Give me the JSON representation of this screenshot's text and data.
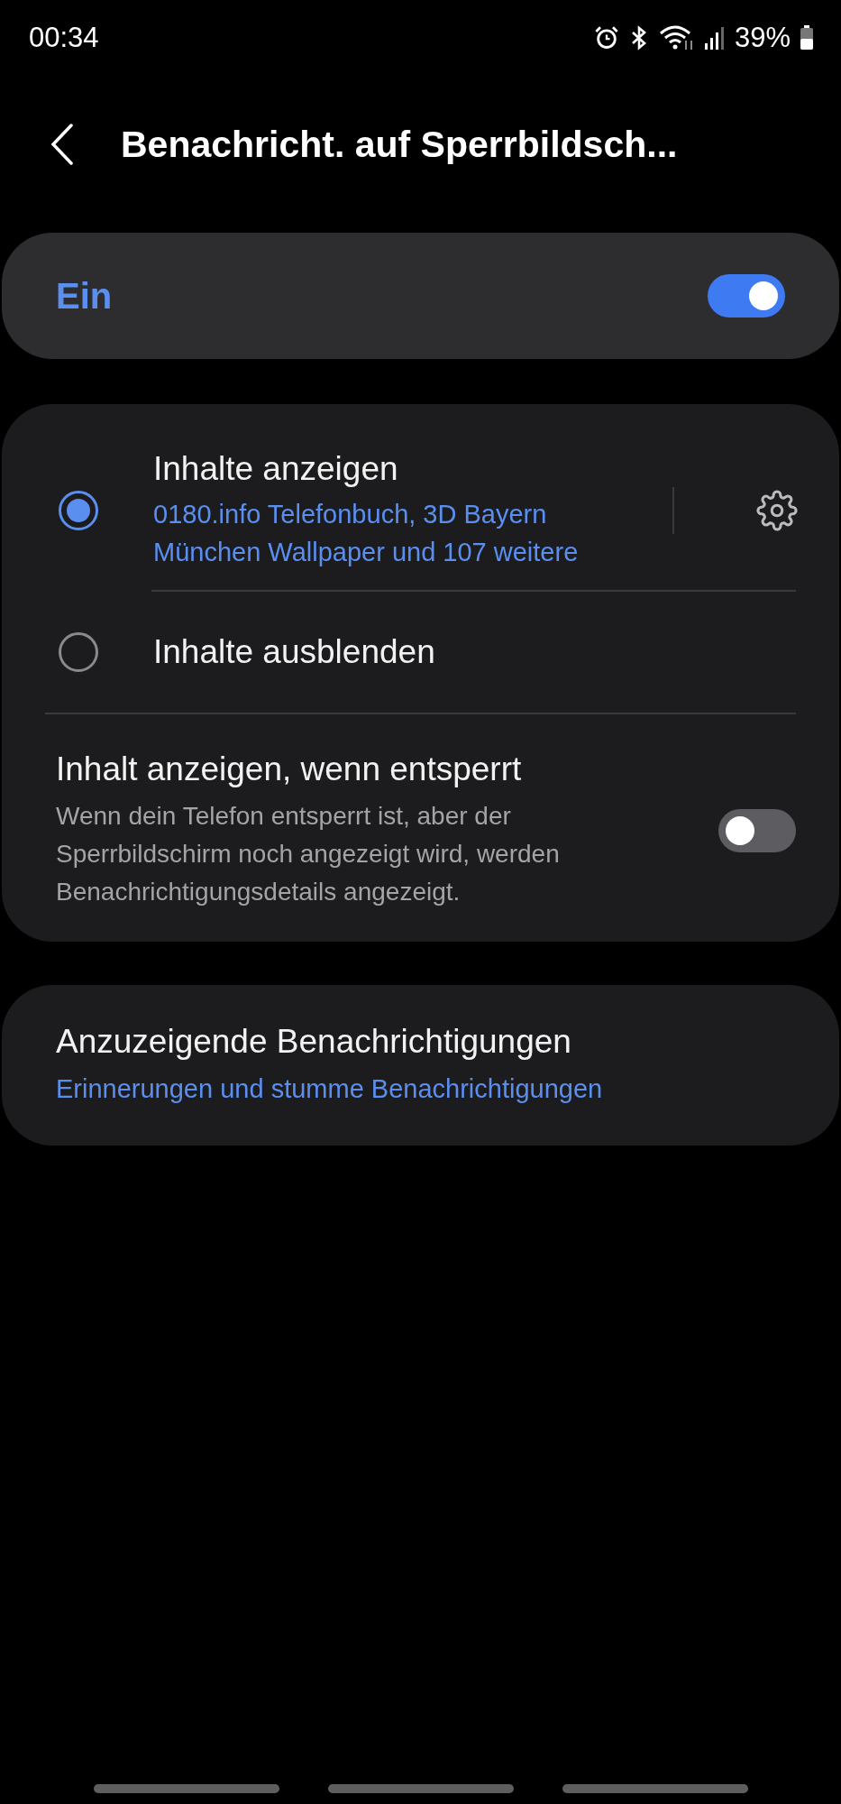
{
  "status_bar": {
    "time": "00:34",
    "battery": "39%"
  },
  "header": {
    "title": "Benachricht. auf Sperrbildsch..."
  },
  "master": {
    "label": "Ein",
    "on": true
  },
  "options": [
    {
      "label": "Inhalte anzeigen",
      "subtitle": "0180.info Telefonbuch, 3D Bayern München Wallpaper und 107 weitere",
      "selected": true,
      "settings": true
    },
    {
      "label": "Inhalte ausblenden",
      "selected": false,
      "settings": false
    }
  ],
  "unlock": {
    "title": "Inhalt anzeigen, wenn entsperrt",
    "description": "Wenn dein Telefon entsperrt ist, aber der Sperrbildschirm noch angezeigt wird, werden Benachrichtigungsdetails angezeigt.",
    "on": false
  },
  "notifications": {
    "title": "Anzuzeigende Benachrichtigungen",
    "subtitle": "Erinnerungen und stumme Benachrichtigungen"
  }
}
